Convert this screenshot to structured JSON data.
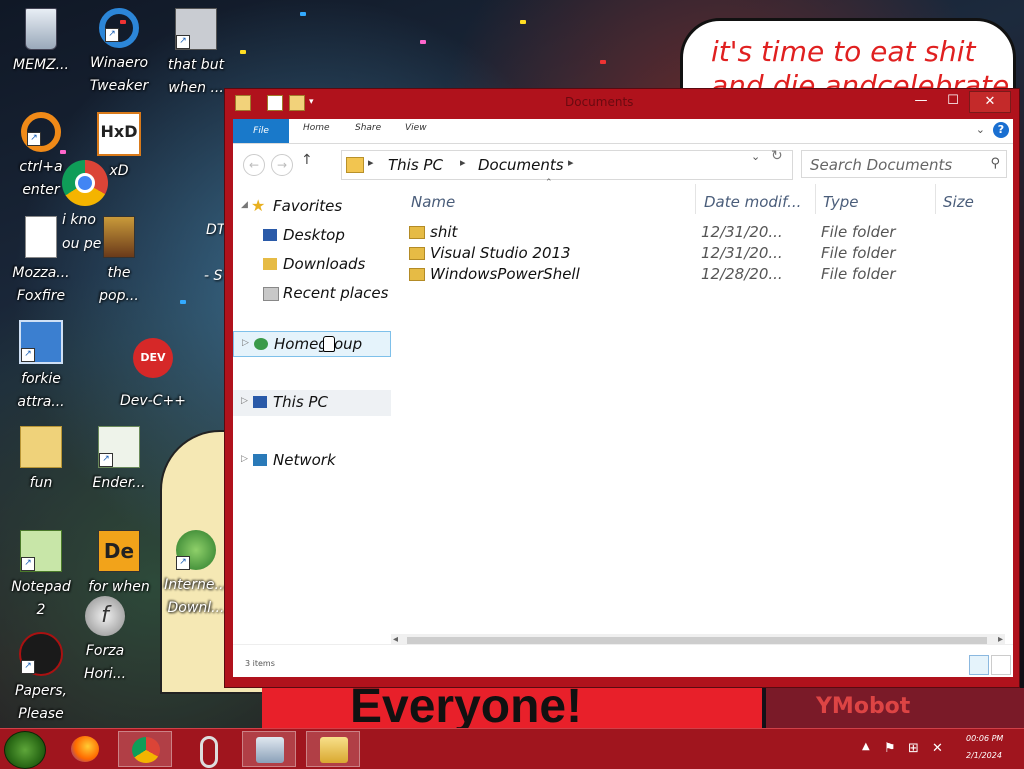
{
  "desktop": {
    "wallpaper": {
      "top_bubble_text": "it's time to eat shit",
      "top_bubble_text_2": "and die andcelebrate",
      "bottom_banner_text": "Everyone!",
      "bottom_right_text": "YMobot"
    },
    "icons": [
      {
        "label": "MEMZ...",
        "label2": "",
        "icon": "recycle-bin-icon"
      },
      {
        "label": "Winaero",
        "label2": "Tweaker",
        "icon": "winaero-tweaker-icon"
      },
      {
        "label": "that but",
        "label2": "when ...",
        "icon": "windows-stack-icon"
      },
      {
        "label": "ctrl+a",
        "label2": "enter",
        "icon": "orange-ring-icon"
      },
      {
        "label": "xD",
        "label2": "",
        "icon": "hxd-icon"
      },
      {
        "label": "Mozza...",
        "label2": "Foxfire",
        "icon": "document-icon"
      },
      {
        "label": "the",
        "label2": "pop...",
        "icon": "image-icon"
      },
      {
        "label": "forkie",
        "label2": "attra...",
        "icon": "settings-monitor-icon"
      },
      {
        "label": "Dev-C++",
        "label2": "",
        "icon": "dev-cpp-icon"
      },
      {
        "label": "fun",
        "label2": "",
        "icon": "folder-icon"
      },
      {
        "label": "Ender...",
        "label2": "",
        "icon": "app-window-icon"
      },
      {
        "label": "Notepad",
        "label2": "2",
        "icon": "notepad2-icon"
      },
      {
        "label": "for when",
        "label2": "...",
        "icon": "de-icon"
      },
      {
        "label": "Interne...",
        "label2": "Downl...",
        "icon": "internet-download-icon"
      },
      {
        "label": "Forza",
        "label2": "Hori...",
        "icon": "flash-icon"
      },
      {
        "label": "Papers,",
        "label2": "Please",
        "icon": "papers-please-icon"
      }
    ],
    "partial_labels": [
      "i kno",
      "ou pe",
      "DT",
      "- S"
    ]
  },
  "window": {
    "title": "Documents",
    "controls": {
      "minimize": "—",
      "maximize": "☐",
      "close": "✕"
    },
    "ribbon": {
      "tabs": [
        "File",
        "Home",
        "Share",
        "View"
      ],
      "help": "?"
    },
    "address": {
      "crumbs": [
        "This PC",
        "Documents"
      ],
      "dropdown": "⌄"
    },
    "search": {
      "placeholder": "Search Documents"
    },
    "nav_pane": {
      "favorites": "Favorites",
      "desktop": "Desktop",
      "downloads": "Downloads",
      "recent": "Recent places",
      "homegroup": "Homegroup",
      "this_pc": "This PC",
      "network": "Network"
    },
    "columns": {
      "name": "Name",
      "date": "Date modif...",
      "type": "Type",
      "size": "Size"
    },
    "files": [
      {
        "name": "shit",
        "date": "12/31/20...",
        "type": "File folder"
      },
      {
        "name": "Visual Studio 2013",
        "date": "12/31/20...",
        "type": "File folder"
      },
      {
        "name": "WindowsPowerShell",
        "date": "12/28/20...",
        "type": "File folder"
      }
    ],
    "status": "3 items"
  },
  "taskbar": {
    "apps": [
      {
        "name": "firefox-icon"
      },
      {
        "name": "chrome-icon"
      },
      {
        "name": "paperclip-icon"
      },
      {
        "name": "system-monitor-icon"
      },
      {
        "name": "file-explorer-icon"
      }
    ],
    "clock": {
      "time": "00:06 PM",
      "date": "2/1/2024"
    }
  },
  "colors": {
    "window_frame": "#b0121c",
    "taskbar": "#a0151e",
    "accent": "#1979ca"
  }
}
